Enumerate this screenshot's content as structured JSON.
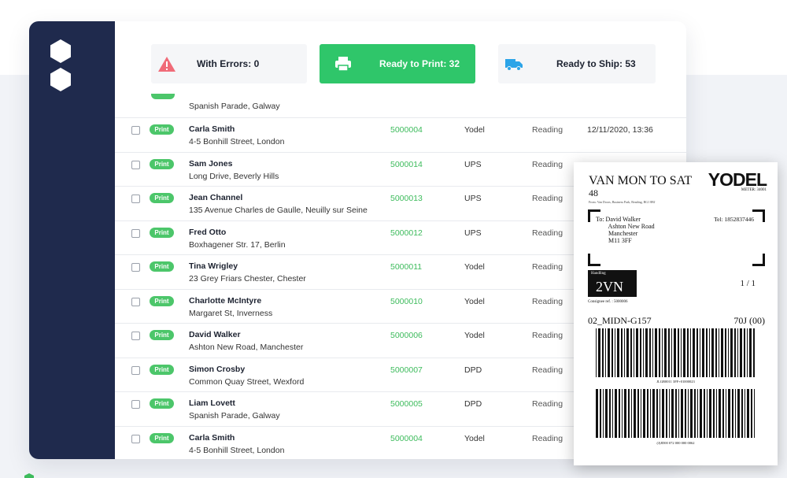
{
  "stats": {
    "errors": {
      "label": "With Errors: 0",
      "icon": "warning-icon",
      "color": "#f06b78"
    },
    "print": {
      "label": "Ready to Print: 32",
      "icon": "printer-icon",
      "color": "#2fc66a"
    },
    "ship": {
      "label": "Ready to Ship: 53",
      "icon": "truck-icon",
      "color": "#2ba4e8"
    }
  },
  "partial_row": {
    "address": "Spanish Parade, Galway"
  },
  "pill_label": "Print",
  "orders": [
    {
      "name": "Carla Smith",
      "address": "4-5 Bonhill Street, London",
      "order_id": "5000004",
      "carrier": "Yodel",
      "destination": "Reading",
      "time": "12/11/2020, 13:36"
    },
    {
      "name": "Sam Jones",
      "address": "Long Drive, Beverly Hills",
      "order_id": "5000014",
      "carrier": "UPS",
      "destination": "Reading",
      "time": ""
    },
    {
      "name": "Jean Channel",
      "address": "135 Avenue Charles de Gaulle, Neuilly sur Seine",
      "order_id": "5000013",
      "carrier": "UPS",
      "destination": "Reading",
      "time": ""
    },
    {
      "name": "Fred Otto",
      "address": "Boxhagener Str. 17, Berlin",
      "order_id": "5000012",
      "carrier": "UPS",
      "destination": "Reading",
      "time": ""
    },
    {
      "name": "Tina Wrigley",
      "address": "23 Grey Friars Chester, Chester",
      "order_id": "5000011",
      "carrier": "Yodel",
      "destination": "Reading",
      "time": ""
    },
    {
      "name": "Charlotte McIntyre",
      "address": "Margaret St, Inverness",
      "order_id": "5000010",
      "carrier": "Yodel",
      "destination": "Reading",
      "time": ""
    },
    {
      "name": "David Walker",
      "address": "Ashton New Road, Manchester",
      "order_id": "5000006",
      "carrier": "Yodel",
      "destination": "Reading",
      "time": ""
    },
    {
      "name": "Simon Crosby",
      "address": "Common Quay Street, Wexford",
      "order_id": "5000007",
      "carrier": "DPD",
      "destination": "Reading",
      "time": ""
    },
    {
      "name": "Liam Lovett",
      "address": "Spanish Parade, Galway",
      "order_id": "5000005",
      "carrier": "DPD",
      "destination": "Reading",
      "time": ""
    },
    {
      "name": "Carla Smith",
      "address": "4-5 Bonhill Street, London",
      "order_id": "5000004",
      "carrier": "Yodel",
      "destination": "Reading",
      "time": ""
    }
  ],
  "shipping_label": {
    "service": "VAN MON TO SAT",
    "service_number": "48",
    "from_line": "From: Van Doors, Business Park, Reading, RG1 8BJ",
    "brand": "YODEL",
    "meter": "METER: 34001",
    "to_block": "To: David Walker\n        Ashton New Road\n        Manchester\n        M11 3FF",
    "tel": "Tel: 1852837446",
    "handling_label": "Handling",
    "handling_code": "2VN",
    "ratio": "1 / 1",
    "consignee": "Consignee ref. : 5000006",
    "route": "02_MIDN-G157",
    "route_code": "70J (00)",
    "barcode1_text": "JLGB0011 3FF+01000023",
    "barcode2_text": "(J)JD00 072 000 000 0062"
  }
}
